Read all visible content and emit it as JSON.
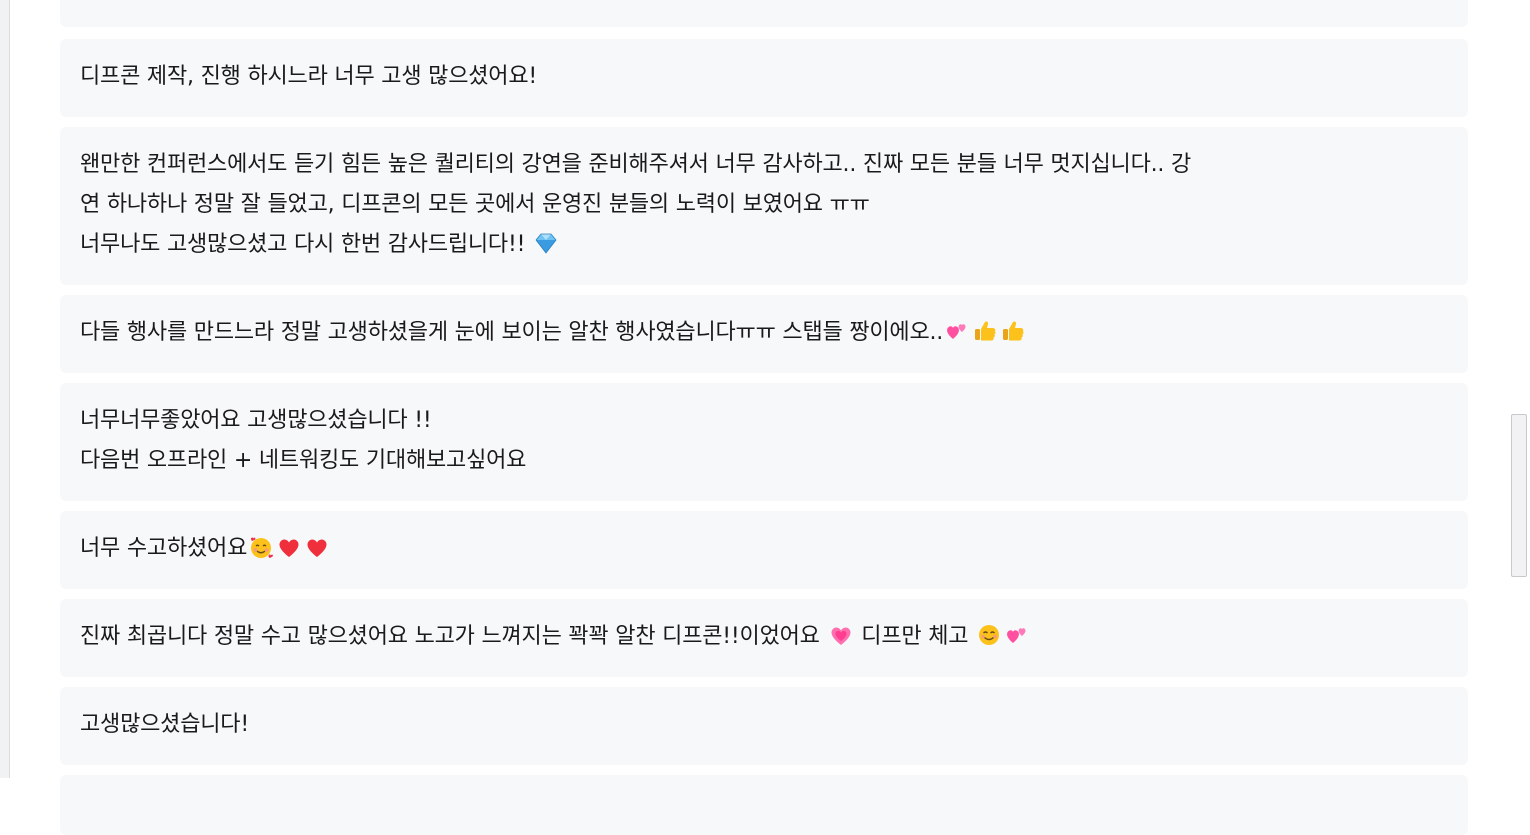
{
  "comments": [
    {
      "id": "c0",
      "lines": [
        ""
      ]
    },
    {
      "id": "c1",
      "lines": [
        "디프콘 제작, 진행 하시느라 너무 고생 많으셨어요!"
      ]
    },
    {
      "id": "c2",
      "lines": [
        "왠만한 컨퍼런스에서도 듣기 힘든 높은 퀄리티의 강연을 준비해주셔서 너무 감사하고.. 진짜 모든 분들 너무 멋지십니다.. 강",
        "연 하나하나 정말 잘 들었고, 디프콘의 모든 곳에서 운영진 분들의 노력이 보였어요 ㅠㅠ",
        "너무나도 고생많으셨고 다시 한번 감사드립니다!!"
      ],
      "trailing_emoji": [
        "gem-icon"
      ]
    },
    {
      "id": "c3",
      "lines": [
        "다들 행사를 만드느라 정말 고생하셨을게 눈에 보이는 알찬 행사였습니다ㅠㅠ 스탭들 짱이에오.."
      ],
      "trailing_emoji": [
        "two-hearts-icon",
        "thumbs-up-icon",
        "thumbs-up-icon"
      ]
    },
    {
      "id": "c4",
      "lines": [
        "너무너무좋았어요 고생많으셨습니다 !!",
        "다음번 오프라인 + 네트워킹도 기대해보고싶어요"
      ]
    },
    {
      "id": "c5",
      "lines": [
        "너무 수고하셨어요"
      ],
      "trailing_emoji": [
        "smiling-face-with-hearts-icon",
        "red-heart-icon",
        "red-heart-icon"
      ]
    },
    {
      "id": "c6",
      "segments": [
        "진짜 최곱니다 정말 수고 많으셨어요 노고가 느껴지는 꽉꽉 알찬 디프콘!!이었어요 ",
        " 디프만 체고 "
      ],
      "segment_emoji": [
        "growing-heart-icon",
        "smiling-face-icon",
        "two-hearts-icon"
      ]
    },
    {
      "id": "c7",
      "lines": [
        "고생많으셨습니다!"
      ]
    },
    {
      "id": "c8",
      "lines": [
        ""
      ]
    }
  ],
  "colors": {
    "card_bg": "#f7f8fa",
    "text": "#1a1a1a",
    "page_bg": "#ffffff",
    "scrollbar_thumb": "#f2f2f4",
    "scrollbar_border": "#c8c9cc"
  }
}
